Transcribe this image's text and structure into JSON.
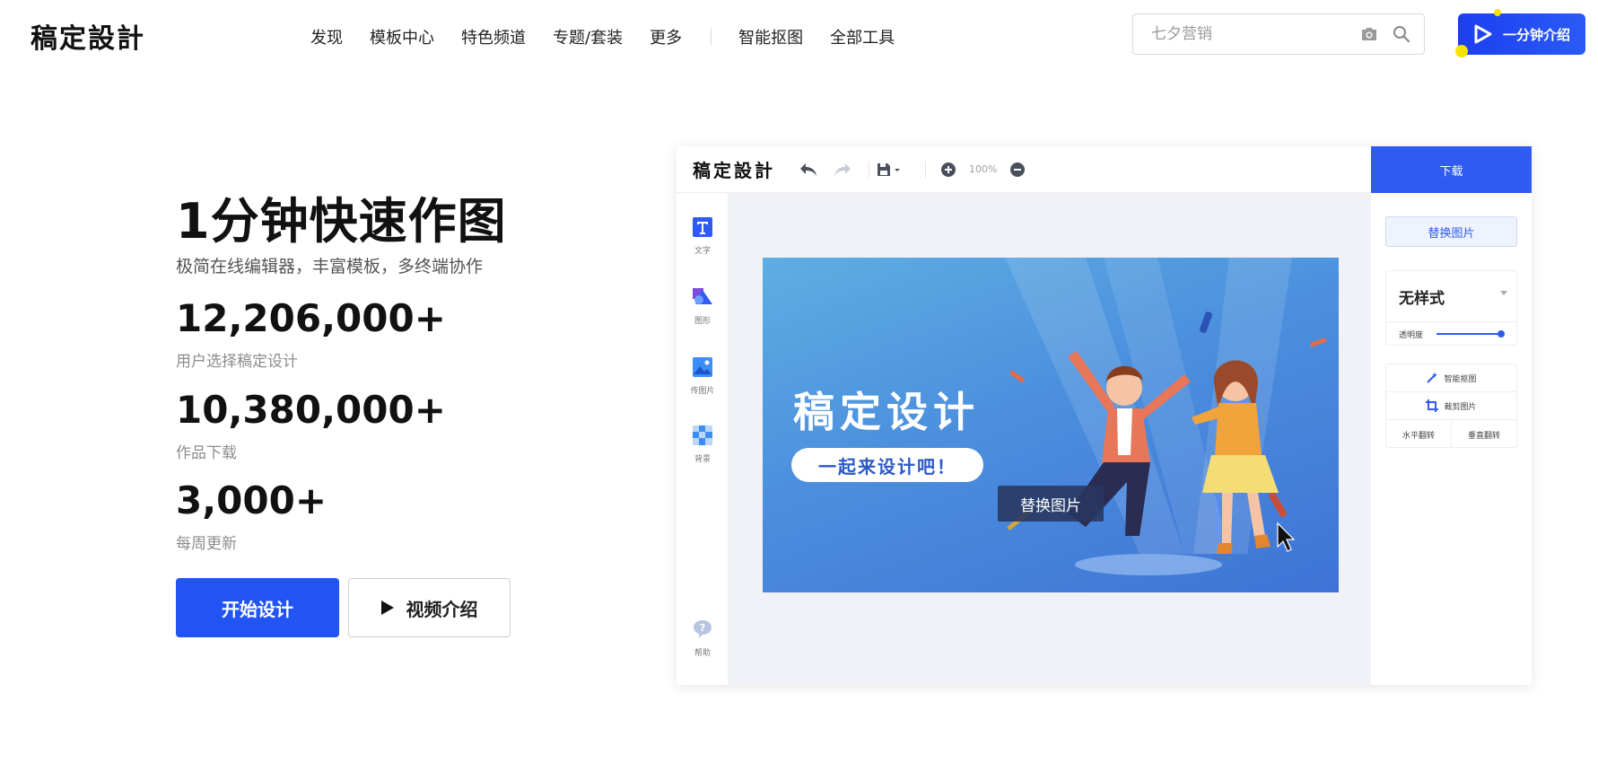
{
  "header": {
    "logo": "稿定設計",
    "nav": [
      "发现",
      "模板中心",
      "特色频道",
      "专题/套装",
      "更多"
    ],
    "nav_tools": [
      "智能抠图",
      "全部工具"
    ],
    "search_placeholder": "七夕营销",
    "video_button": "一分钟介绍"
  },
  "hero": {
    "title": "1分钟快速作图",
    "subtitle": "极简在线编辑器，丰富模板，多终端协作",
    "stats": [
      {
        "value": "12,206,000+",
        "label": "用户选择稿定设计"
      },
      {
        "value": "10,380,000+",
        "label": "作品下载"
      },
      {
        "value": "3,000+",
        "label": "每周更新"
      }
    ],
    "start_button": "开始设计",
    "video_button": "视频介绍"
  },
  "editor": {
    "logo": "稿定設計",
    "zoom": "100%",
    "download": "下载",
    "sidebar": [
      "文字",
      "图形",
      "传图片",
      "背景",
      "帮助"
    ],
    "panel": {
      "replace_button": "替换图片",
      "style_name": "无样式",
      "opacity_label": "透明度",
      "opacity_value": 1.0,
      "smart_cutout": "智能抠图",
      "crop_image": "裁剪图片",
      "flip_h": "水平翻转",
      "flip_v": "垂直翻转"
    },
    "banner": {
      "title": "稿定设计",
      "pill": "一起来设计吧！",
      "replace_tag": "替换图片"
    }
  },
  "colors": {
    "accent": "#2254f4",
    "editor_accent": "#2f5bf0",
    "highlight": "#f6e200"
  }
}
